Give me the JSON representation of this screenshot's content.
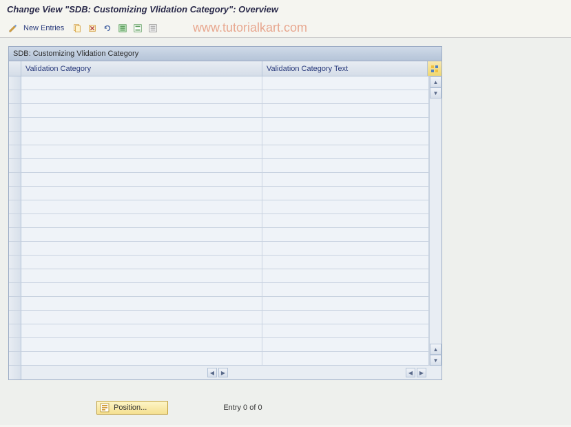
{
  "header": {
    "title": "Change View \"SDB: Customizing Vlidation Category\": Overview"
  },
  "toolbar": {
    "new_entries_label": "New Entries"
  },
  "watermark": "www.tutorialkart.com",
  "table": {
    "title": "SDB: Customizing Vlidation Category",
    "columns": {
      "col1": "Validation Category",
      "col2": "Validation Category Text"
    },
    "row_count": 21
  },
  "footer": {
    "position_label": "Position...",
    "entry_status": "Entry 0 of 0"
  }
}
